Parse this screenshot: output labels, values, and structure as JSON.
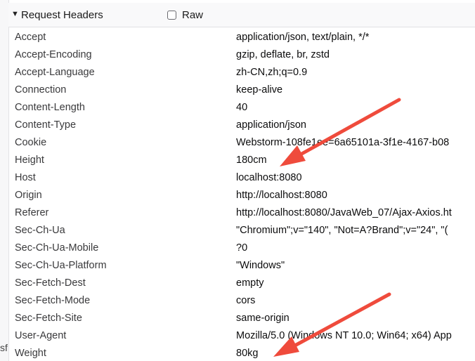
{
  "section": {
    "title": "Request Headers",
    "raw_label": "Raw",
    "raw_checked": false
  },
  "left_fragment": "sf",
  "headers": [
    {
      "name": "Accept",
      "value": "application/json, text/plain, */*"
    },
    {
      "name": "Accept-Encoding",
      "value": "gzip, deflate, br, zstd"
    },
    {
      "name": "Accept-Language",
      "value": "zh-CN,zh;q=0.9"
    },
    {
      "name": "Connection",
      "value": "keep-alive"
    },
    {
      "name": "Content-Length",
      "value": "40"
    },
    {
      "name": "Content-Type",
      "value": "application/json"
    },
    {
      "name": "Cookie",
      "value": "Webstorm-108fe1ee=6a65101a-3f1e-4167-b08"
    },
    {
      "name": "Height",
      "value": "180cm"
    },
    {
      "name": "Host",
      "value": "localhost:8080"
    },
    {
      "name": "Origin",
      "value": "http://localhost:8080"
    },
    {
      "name": "Referer",
      "value": "http://localhost:8080/JavaWeb_07/Ajax-Axios.ht"
    },
    {
      "name": "Sec-Ch-Ua",
      "value": "\"Chromium\";v=\"140\", \"Not=A?Brand\";v=\"24\", \"("
    },
    {
      "name": "Sec-Ch-Ua-Mobile",
      "value": "?0"
    },
    {
      "name": "Sec-Ch-Ua-Platform",
      "value": "\"Windows\""
    },
    {
      "name": "Sec-Fetch-Dest",
      "value": "empty"
    },
    {
      "name": "Sec-Fetch-Mode",
      "value": "cors"
    },
    {
      "name": "Sec-Fetch-Site",
      "value": "same-origin"
    },
    {
      "name": "User-Agent",
      "value": "Mozilla/5.0 (Windows NT 10.0; Win64; x64) App"
    },
    {
      "name": "Weight",
      "value": "80kg"
    }
  ],
  "colors": {
    "annotation_arrow": "#ef4b3c",
    "header_bg": "#f9f9fa"
  }
}
